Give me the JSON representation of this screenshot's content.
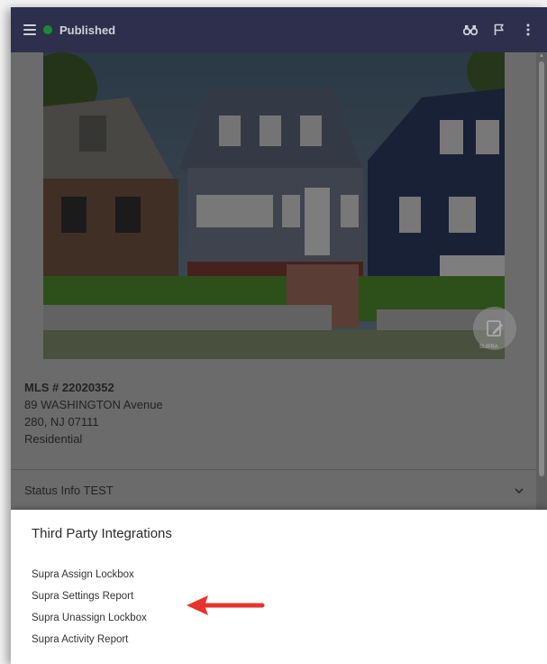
{
  "appbar": {
    "status_label": "Published",
    "status_color": "#1c8a2e",
    "background": "#2d2f4c",
    "icons": [
      "menu-icon",
      "binoculars-icon",
      "flag-icon",
      "more-vert-icon"
    ]
  },
  "listing": {
    "mls": "MLS # 22020352",
    "address_line1": "89 WASHINGTON Avenue",
    "address_line2": "280, NJ 07111",
    "property_type": "Residential",
    "fab_label": "SUPRA"
  },
  "status_section": {
    "label": "Status Info TEST"
  },
  "sheet": {
    "title": "Third Party Integrations",
    "items": [
      "Supra Assign Lockbox",
      "Supra Settings Report",
      "Supra Unassign Lockbox",
      "Supra Activity Report"
    ]
  },
  "annotation": {
    "arrow_color": "#e8332d"
  }
}
